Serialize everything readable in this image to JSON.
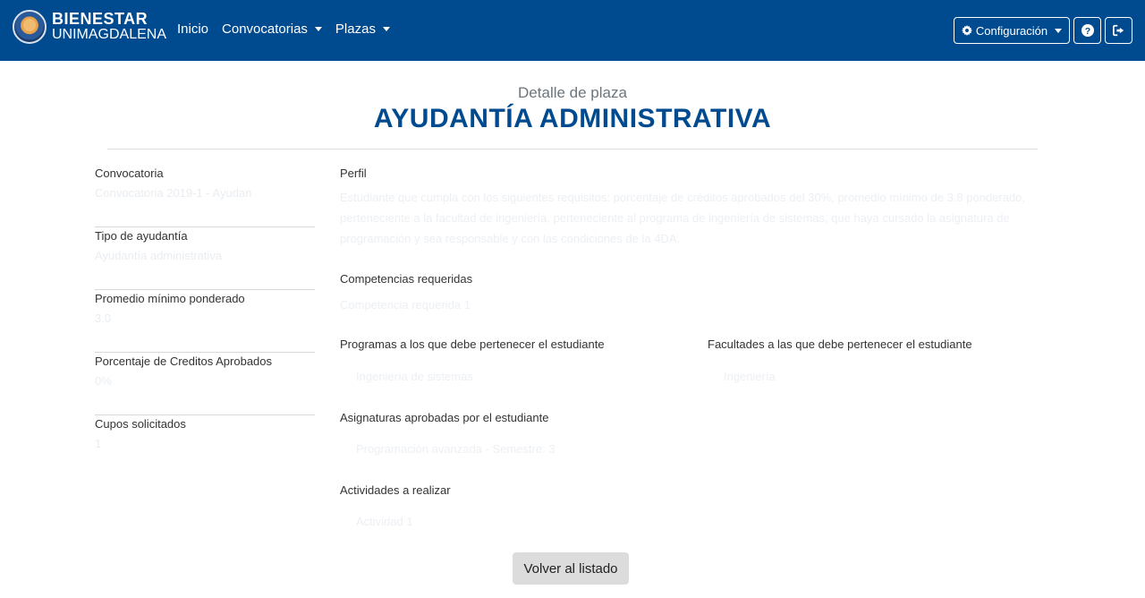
{
  "brand": {
    "title": "BIENESTAR",
    "subtitle": "UNIMAGDALENA"
  },
  "nav": {
    "items": [
      {
        "label": "Inicio"
      },
      {
        "label": "Convocatorias"
      },
      {
        "label": "Plazas"
      }
    ],
    "config_label": "Configuración",
    "icons": {
      "help": "question-circle-icon",
      "logout": "sign-out-icon",
      "config": "gear-icon"
    }
  },
  "header": {
    "subtitle": "Detalle de plaza",
    "title": "AYUDANTÍA ADMINISTRATIVA"
  },
  "left_fields": [
    {
      "label": "Convocatoria",
      "value": "Convocatoria 2019-1 - Ayudan"
    },
    {
      "label": "Tipo de ayudantía",
      "value": "Ayudantía administrativa"
    },
    {
      "label": "Promedio mínimo ponderado",
      "value": "3.0"
    },
    {
      "label": "Porcentaje de Creditos Aprobados",
      "value": "0%"
    },
    {
      "label": "Cupos solicitados",
      "value": "1"
    }
  ],
  "right": {
    "perfil_label": "Perfil",
    "perfil_value": "Estudiante que cumpla con los siguientes requisitos: porcentaje de créditos aprobados del 30%, promedio mínimo de 3.8 ponderado, perteneciente a la facultad de ingeniería, perteneciente al programa de ingeniería de sistemas, que haya cursado la asignatura de programación y sea responsable y con las condiciones de la 4DA.",
    "competencias_label": "Competencias requeridas",
    "competencias_value": "Competencia requerida 1",
    "programas_label": "Programas a los que debe pertenecer el estudiante",
    "programas_value": "Ingeniería de sistemas",
    "facultades_label": "Facultades a las que debe pertenecer el estudiante",
    "facultades_value": "Ingeniería",
    "asignaturas_label": "Asignaturas aprobadas por el estudiante",
    "asignaturas_value": "Programación avanzada - Semestre: 3",
    "actividades_label": "Actividades a realizar",
    "actividades_value": "Actividad 1"
  },
  "footer": {
    "back_label": "Volver al listado"
  }
}
